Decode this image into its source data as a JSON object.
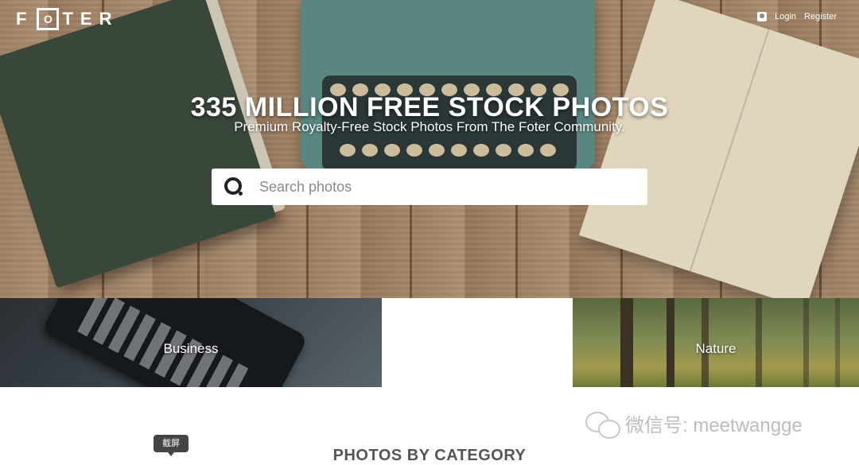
{
  "logo": {
    "left": "F",
    "box": "O",
    "right": "TER"
  },
  "nav": {
    "login": "Login",
    "register": "Register"
  },
  "hero": {
    "title": "335 MILLION FREE STOCK PHOTOS",
    "subtitle": "Premium Royalty-Free Stock Photos From The Foter Community."
  },
  "search": {
    "placeholder": "Search photos"
  },
  "categories": [
    {
      "label": "Business"
    },
    {
      "label": ""
    },
    {
      "label": "Nature"
    }
  ],
  "section": {
    "title": "PHOTOS BY CATEGORY"
  },
  "tooltip": {
    "text": "截屏"
  },
  "watermark": {
    "text": "微信号: meetwangge"
  },
  "colors": {
    "search_bg": "#ffffff",
    "hero_text": "#ffffff",
    "section_title": "#555555"
  }
}
